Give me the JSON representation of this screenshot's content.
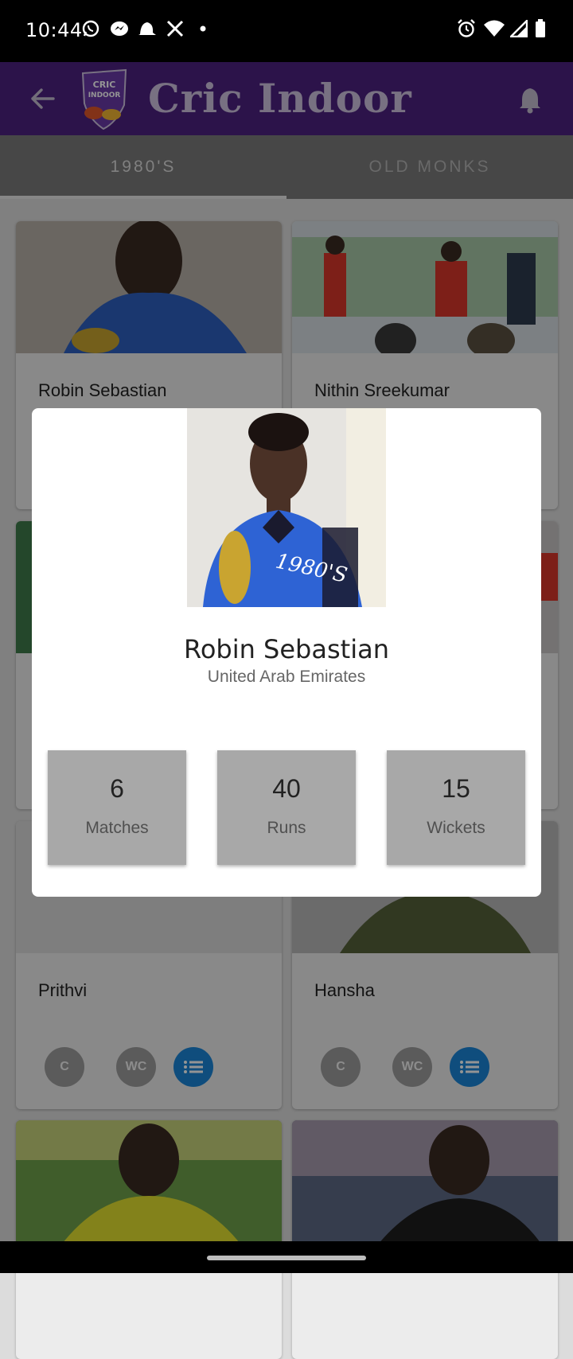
{
  "status_bar": {
    "time": "10:44",
    "left_icons": [
      "whatsapp-icon",
      "messenger-icon",
      "bell-app-icon",
      "x-icon",
      "dot-icon"
    ],
    "right_icons": [
      "alarm-icon",
      "wifi-icon",
      "cell-signal-icon",
      "battery-icon"
    ]
  },
  "app_bar": {
    "title": "Cric Indoor",
    "logo_text_line1": "CRIC",
    "logo_text_line2": "INDOOR",
    "background": "#4d2280"
  },
  "tabs": [
    {
      "label": "1980'S",
      "active": true
    },
    {
      "label": "OLD MONKS",
      "active": false
    }
  ],
  "players": [
    {
      "name": "Robin Sebastian"
    },
    {
      "name": "Nithin Sreekumar"
    },
    {
      "name": ""
    },
    {
      "name": ""
    },
    {
      "name": "Prithvi",
      "chips": [
        "C",
        "WC"
      ]
    },
    {
      "name": "Hansha",
      "chips": [
        "C",
        "WC"
      ]
    },
    {
      "name": ""
    },
    {
      "name": ""
    }
  ],
  "dialog": {
    "name": "Robin Sebastian",
    "country": "United Arab Emirates",
    "stats": [
      {
        "value": "6",
        "label": "Matches"
      },
      {
        "value": "40",
        "label": "Runs"
      },
      {
        "value": "15",
        "label": "Wickets"
      }
    ]
  },
  "colors": {
    "accent_blue": "#1a86d8",
    "chip_gray": "#9e9e9e"
  }
}
